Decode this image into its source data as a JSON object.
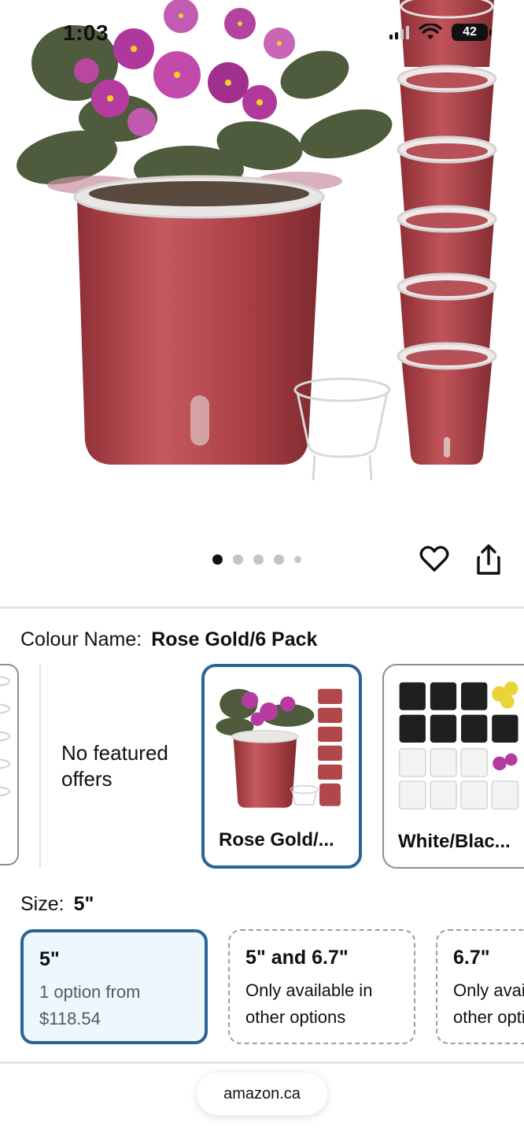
{
  "status_bar": {
    "time": "1:03",
    "battery": "42"
  },
  "carousel": {
    "image_count": 5,
    "active_index": 0
  },
  "colour": {
    "label": "Colour Name:",
    "value": "Rose Gold/6 Pack",
    "no_featured_offers": "No featured offers",
    "options": [
      {
        "label": "Rose Gold/...",
        "selected": true
      },
      {
        "label": "White/Blac...",
        "selected": false
      }
    ]
  },
  "size": {
    "label": "Size:",
    "value": "5\"",
    "options": [
      {
        "title": "5\"",
        "line1": "1 option from",
        "line2": "$118.54",
        "selected": true
      },
      {
        "title": "5\" and 6.7\"",
        "line1": "Only available in",
        "line2": "other options",
        "selected": false
      },
      {
        "title": "6.7\"",
        "line1": "Only available in",
        "line2": "other options",
        "selected": false
      }
    ]
  },
  "browser": {
    "url": "amazon.ca"
  },
  "colors": {
    "accent": "#2a6496",
    "selected_bg": "#eef7fd",
    "pot": "#b0474c"
  }
}
